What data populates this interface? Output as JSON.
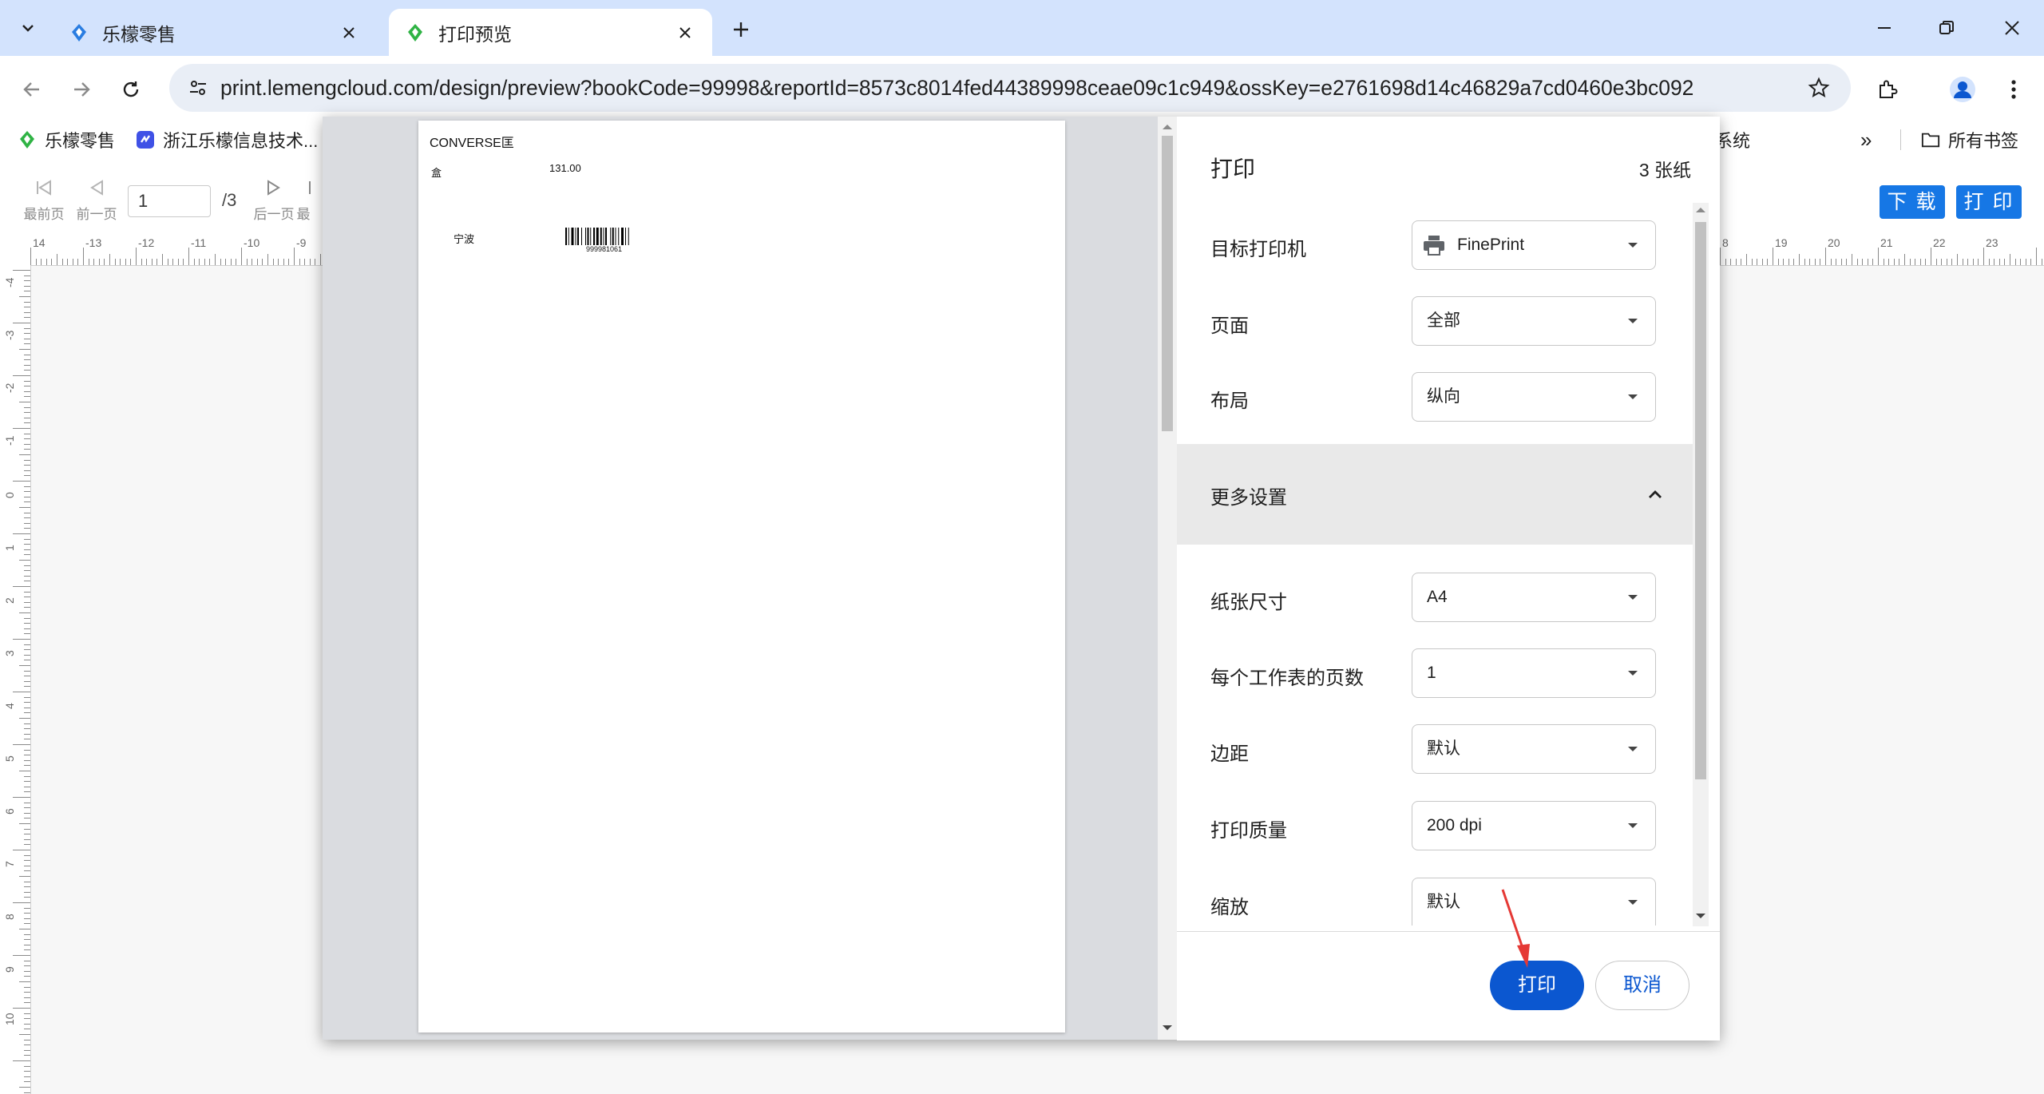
{
  "browser": {
    "tabs": [
      {
        "title": "乐檬零售",
        "active": false
      },
      {
        "title": "打印预览",
        "active": true
      }
    ],
    "url": "print.lemengcloud.com/design/preview?bookCode=99998&reportId=8573c8014fed44389998ceae09c1c949&ossKey=e2761698d14c46829a7cd0460e3bc092",
    "bookmarks": [
      {
        "label": "乐檬零售"
      },
      {
        "label": "浙江乐檬信息技术..."
      },
      {
        "label": "系统"
      }
    ],
    "all_bookmarks": "所有书签",
    "overflow": "»"
  },
  "viewer": {
    "nav": {
      "first": "最前页",
      "prev": "前一页",
      "next": "后一页",
      "last": "最"
    },
    "page_value": "1",
    "page_total": "/3",
    "download_label": "下 载",
    "print_label": "打 印",
    "ruler_top_left": [
      "14",
      "-13",
      "-12",
      "-11",
      "-10",
      "-9"
    ],
    "ruler_top_right": [
      "8",
      "19",
      "20",
      "21",
      "22",
      "23"
    ],
    "ruler_left": [
      "-4",
      "-3",
      "-2",
      "-1",
      "0",
      "1",
      "2",
      "3",
      "4",
      "5",
      "6",
      "7",
      "8",
      "9",
      "10"
    ]
  },
  "preview": {
    "brand": "CONVERSE匡",
    "unit": "盒",
    "price": "131.00",
    "city": "宁波",
    "barcode_number": "999981061"
  },
  "dialog": {
    "title": "打印",
    "sheet_count": "3 张纸",
    "rows_top": [
      {
        "label": "目标打印机",
        "value": "FinePrint"
      },
      {
        "label": "页面",
        "value": "全部"
      },
      {
        "label": "布局",
        "value": "纵向"
      }
    ],
    "more_settings": "更多设置",
    "rows_more": [
      {
        "label": "纸张尺寸",
        "value": "A4"
      },
      {
        "label": "每个工作表的页数",
        "value": "1"
      },
      {
        "label": "边距",
        "value": "默认"
      },
      {
        "label": "打印质量",
        "value": "200 dpi"
      },
      {
        "label": "缩放",
        "value": "默认"
      }
    ],
    "print_button": "打印",
    "cancel_button": "取消"
  },
  "colors": {
    "tabstrip": "#d3e3fd",
    "accent_blue": "#0b57d0",
    "viewer_button": "#1677e5",
    "annotation_arrow": "#e53935"
  }
}
